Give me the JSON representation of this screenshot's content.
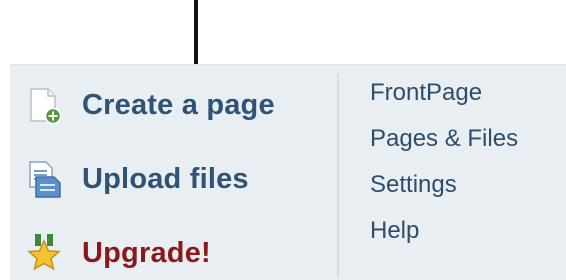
{
  "actions": {
    "create_page": {
      "label": "Create a page",
      "icon": "new-page-icon"
    },
    "upload_files": {
      "label": "Upload files",
      "icon": "upload-files-icon"
    },
    "upgrade": {
      "label": "Upgrade!",
      "icon": "star-icon"
    }
  },
  "links": {
    "frontpage": "FrontPage",
    "pages_files": "Pages & Files",
    "settings": "Settings",
    "help": "Help"
  },
  "colors": {
    "panel_background": "#e9eef3",
    "action_text": "#2f5374",
    "upgrade_text": "#8a1a1a",
    "link_text": "#2f4d6a",
    "arrow": "#111111"
  }
}
